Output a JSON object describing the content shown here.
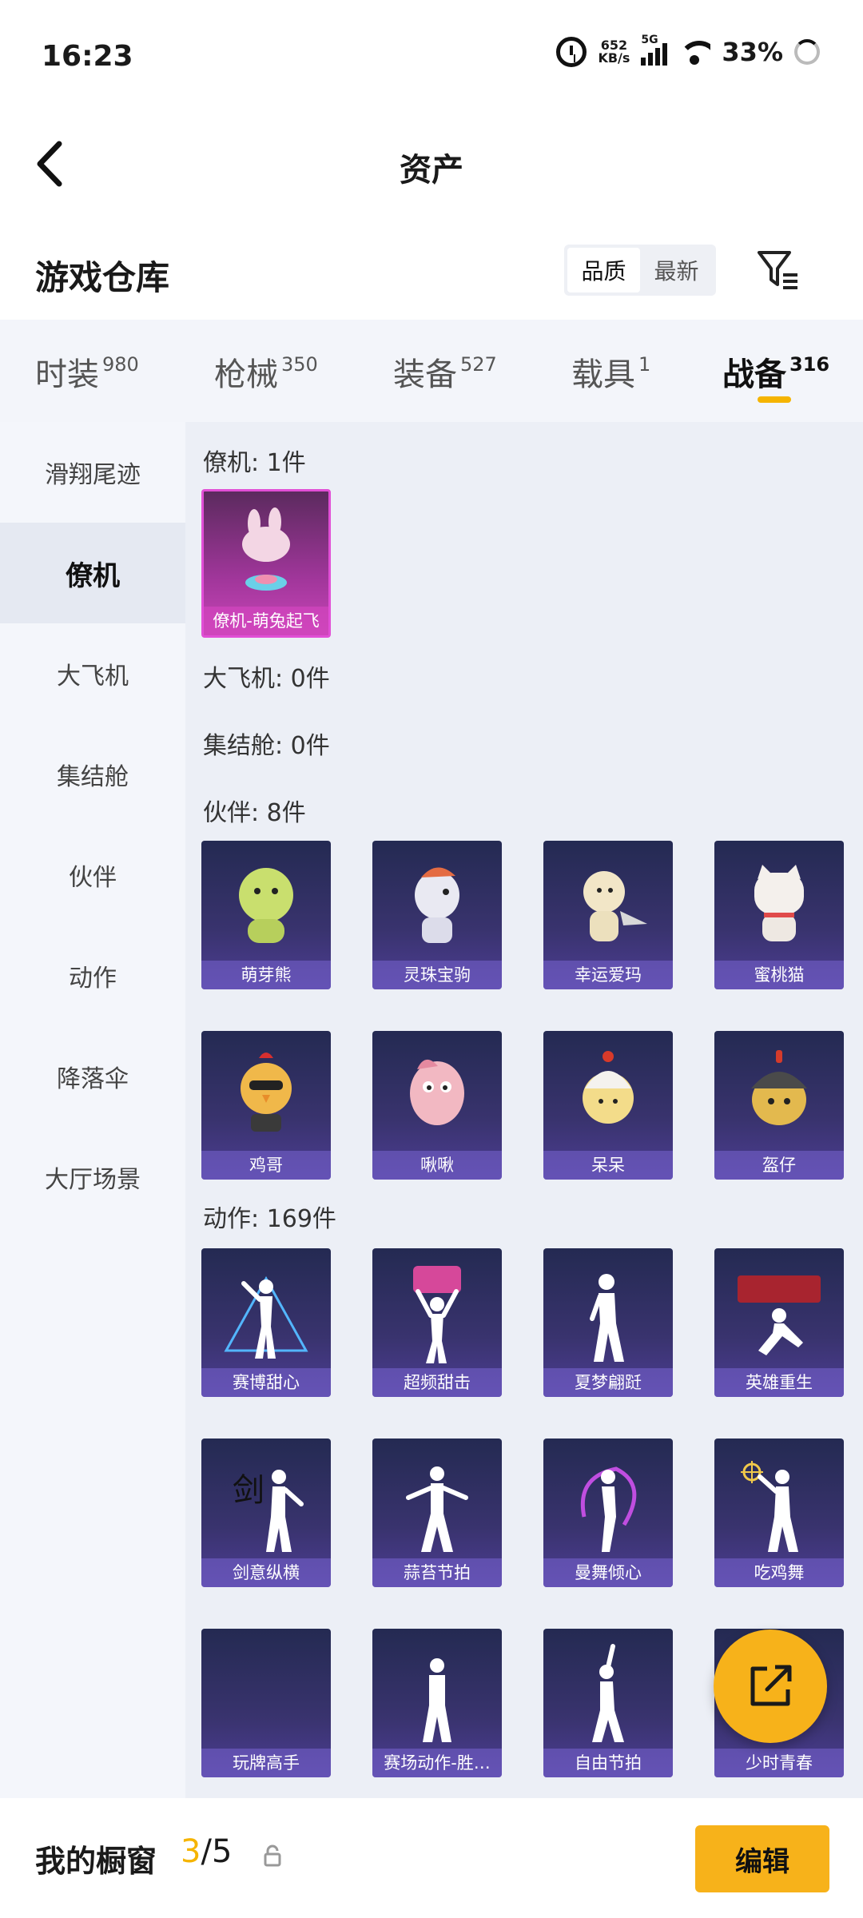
{
  "status_bar": {
    "time": "16:23",
    "net_speed_value": "652",
    "net_speed_unit": "KB/s",
    "network": "5G",
    "battery": "33%"
  },
  "header": {
    "title": "资产"
  },
  "warehouse": {
    "title": "游戏仓库",
    "sort_options": [
      "品质",
      "最新"
    ],
    "active_sort": "品质"
  },
  "tabs": [
    {
      "label": "时装",
      "count": "980"
    },
    {
      "label": "枪械",
      "count": "350"
    },
    {
      "label": "装备",
      "count": "527"
    },
    {
      "label": "载具",
      "count": "1"
    },
    {
      "label": "战备",
      "count": "316",
      "active": true
    }
  ],
  "accent_color": "#f5b400",
  "sidenav": [
    "滑翔尾迹",
    "僚机",
    "大飞机",
    "集结舱",
    "伙伴",
    "动作",
    "降落伞",
    "大厅场景"
  ],
  "sidenav_active": "僚机",
  "sections": {
    "wingman": {
      "title": "僚机: 1件",
      "items": [
        "僚机-萌兔起飞"
      ]
    },
    "bigplane": {
      "title": "大飞机: 0件"
    },
    "capsule": {
      "title": "集结舱: 0件"
    },
    "partner": {
      "title": "伙伴: 8件",
      "items": [
        "萌芽熊",
        "灵珠宝驹",
        "幸运爱玛",
        "蜜桃猫",
        "鸡哥",
        "啾啾",
        "呆呆",
        "盔仔"
      ]
    },
    "emote": {
      "title": "动作: 169件",
      "items": [
        "赛博甜心",
        "超频甜击",
        "夏梦翩跹",
        "英雄重生",
        "剑意纵横",
        "蒜苔节拍",
        "曼舞倾心",
        "吃鸡舞",
        "玩牌高手",
        "赛场动作-胜…",
        "自由节拍",
        "少时青春"
      ]
    }
  },
  "bottom_bar": {
    "label": "我的橱窗",
    "current": "3",
    "separator": "/",
    "total": "5",
    "edit_label": "编辑"
  }
}
